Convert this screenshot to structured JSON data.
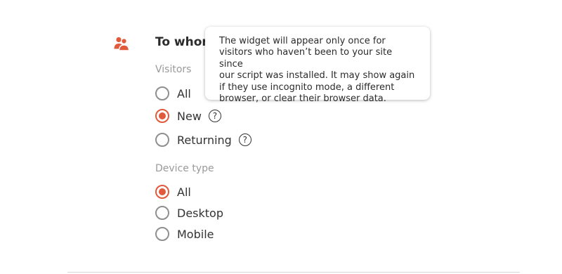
{
  "section": {
    "title": "To whom",
    "icon": "users-icon",
    "accent_color": "#e15a3b"
  },
  "visitors": {
    "label": "Visitors",
    "options": [
      {
        "label": "All",
        "checked": false
      },
      {
        "label": "New",
        "checked": true,
        "help_icon": "?"
      },
      {
        "label": "Returning",
        "checked": false,
        "help_icon": "?"
      }
    ]
  },
  "device_type": {
    "label": "Device type",
    "options": [
      {
        "label": "All",
        "checked": true
      },
      {
        "label": "Desktop",
        "checked": false
      },
      {
        "label": "Mobile",
        "checked": false
      }
    ]
  },
  "tooltip": {
    "lines": [
      "The widget will appear only once for",
      "visitors who haven’t been to your site since",
      "our script was installed. It may show again",
      "if they use incognito mode, a different",
      "browser, or clear their browser data."
    ]
  }
}
